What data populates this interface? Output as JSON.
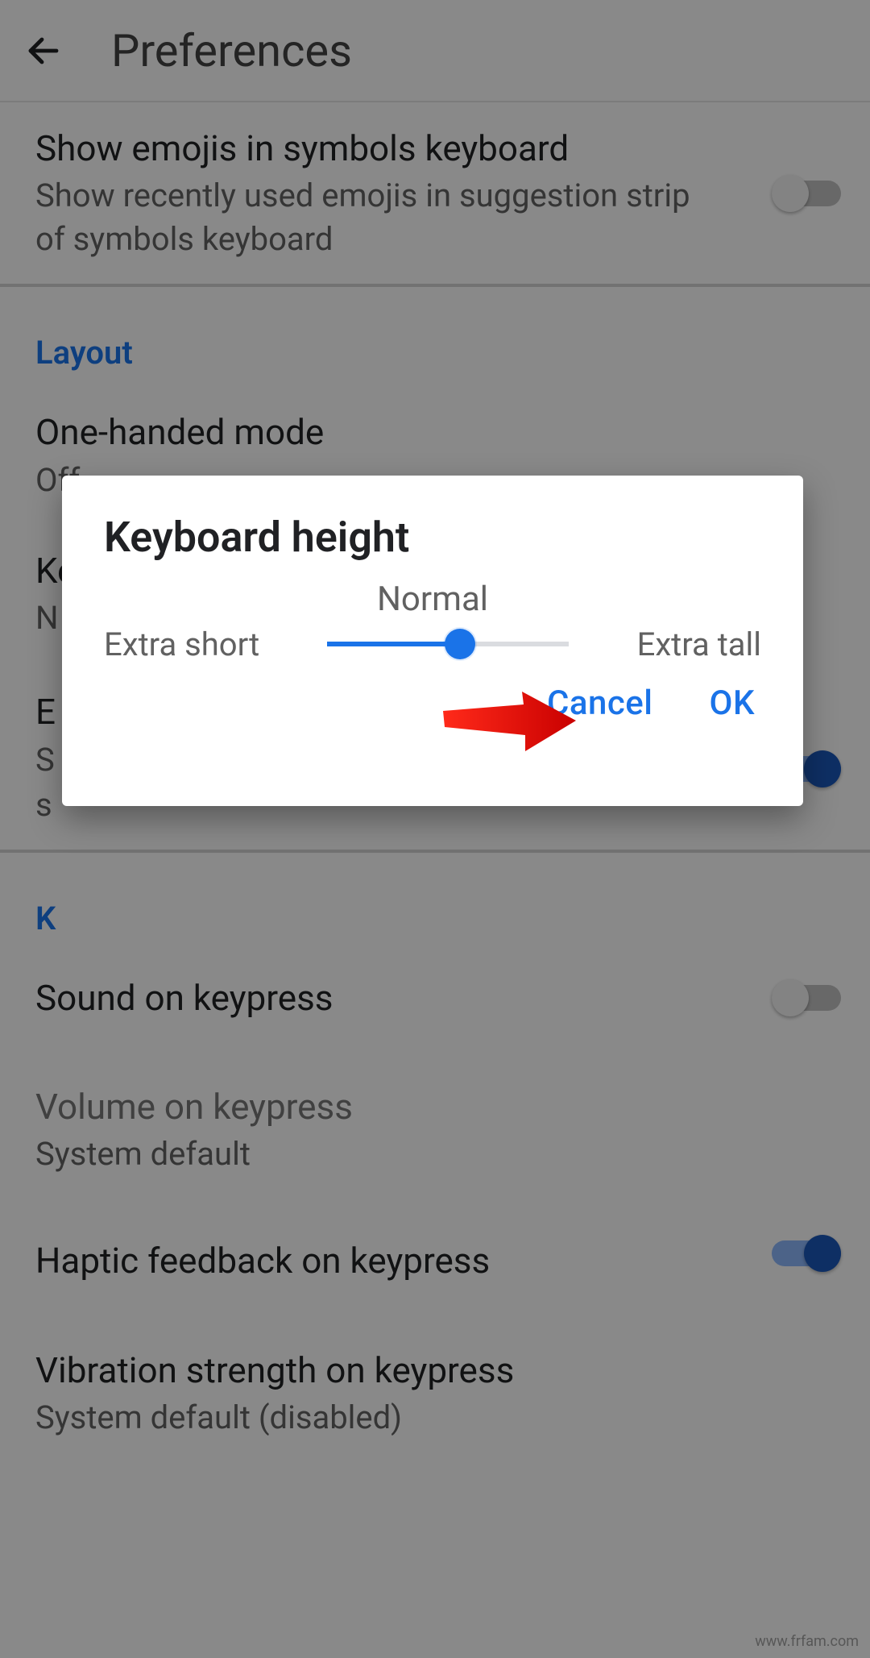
{
  "header": {
    "title": "Preferences"
  },
  "sections": {
    "layout": "Layout",
    "k_partial": "K"
  },
  "settings": {
    "show_emojis": {
      "title": "Show emojis in symbols keyboard",
      "subtitle": "Show recently used emojis in suggestion strip of symbols keyboard",
      "enabled": false
    },
    "one_handed": {
      "title": "One-handed mode",
      "value": "Off"
    },
    "keyboard_height": {
      "title": "Keyboard height",
      "value": "N"
    },
    "partial_e": {
      "title": "E",
      "subtitle_1": "S",
      "subtitle_2": "s",
      "enabled": true
    },
    "sound": {
      "title": "Sound on keypress",
      "enabled": false
    },
    "volume": {
      "title": "Volume on keypress",
      "value": "System default"
    },
    "haptic": {
      "title": "Haptic feedback on keypress",
      "enabled": true
    },
    "vibration": {
      "title": "Vibration strength on keypress",
      "value": "System default (disabled)"
    }
  },
  "dialog": {
    "title": "Keyboard height",
    "current_label": "Normal",
    "min_label": "Extra short",
    "max_label": "Extra tall",
    "cancel": "Cancel",
    "ok": "OK"
  },
  "colors": {
    "accent": "#1a73e8",
    "annotation": "#ff2a1a"
  },
  "watermark": "www.frfam.com"
}
